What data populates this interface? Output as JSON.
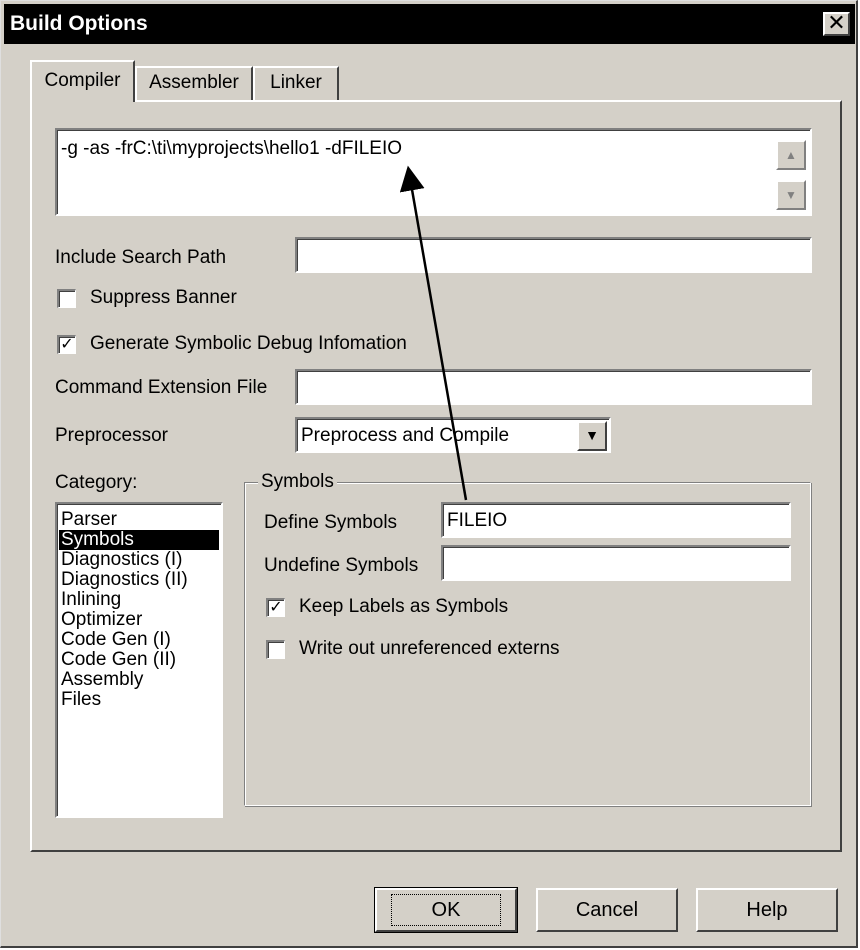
{
  "window": {
    "title": "Build Options",
    "close_glyph": "✕"
  },
  "tabs": [
    {
      "label": "Compiler"
    },
    {
      "label": "Assembler"
    },
    {
      "label": "Linker"
    }
  ],
  "command_line": {
    "value": "-g -as -frC:\\ti\\myprojects\\hello1 -dFILEIO",
    "scroll_up_glyph": "▲",
    "scroll_down_glyph": "▼"
  },
  "include_search_path": {
    "label": "Include Search Path",
    "value": ""
  },
  "suppress_banner": {
    "label": "Suppress Banner",
    "checked": false
  },
  "generate_debug": {
    "label": "Generate Symbolic Debug Infomation",
    "checked": true,
    "check_glyph": "✓"
  },
  "command_extension": {
    "label": "Command Extension File",
    "value": ""
  },
  "preprocessor": {
    "label": "Preprocessor",
    "value": "Preprocess and Compile",
    "dropdown_glyph": "▼"
  },
  "category": {
    "label": "Category:",
    "items": [
      "Parser",
      "Symbols",
      "Diagnostics (I)",
      "Diagnostics (II)",
      "Inlining",
      "Optimizer",
      "Code Gen (I)",
      "Code Gen (II)",
      "Assembly",
      "Files"
    ],
    "selected": "Symbols"
  },
  "symbols": {
    "legend": "Symbols",
    "define_label": "Define Symbols",
    "define_value": "FILEIO",
    "undefine_label": "Undefine Symbols",
    "undefine_value": "",
    "keep_labels": {
      "label": "Keep Labels as Symbols",
      "checked": true,
      "check_glyph": "✓"
    },
    "write_unref": {
      "label": "Write out unreferenced externs",
      "checked": false
    }
  },
  "buttons": {
    "ok": "OK",
    "cancel": "Cancel",
    "help": "Help"
  },
  "colors": {
    "selection_bg": "#000000",
    "dialog_face": "#d4d0c8"
  }
}
